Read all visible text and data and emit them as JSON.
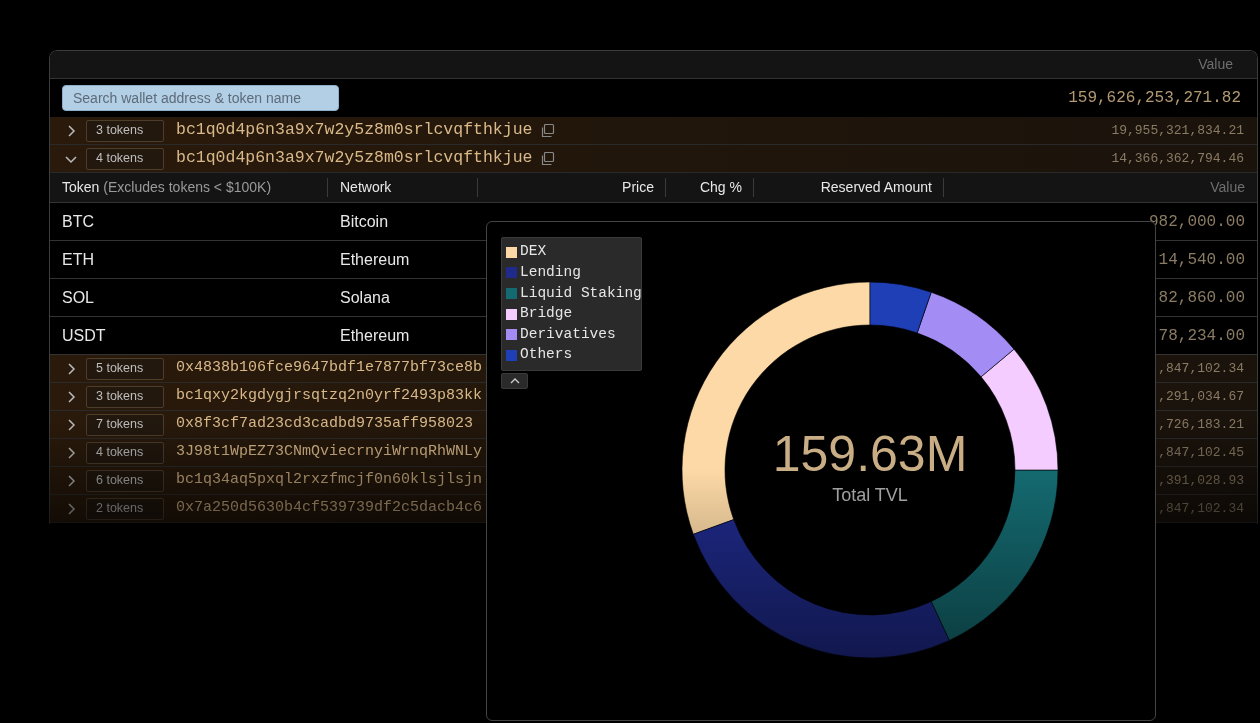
{
  "table": {
    "value_header": "Value",
    "search": {
      "placeholder": "Search wallet address & token name"
    },
    "total": "159,626,253,271.82",
    "wallets": [
      {
        "expanded": false,
        "count": "3 tokens",
        "address": "bc1q0d4p6n3a9x7w2y5z8m0srlcvqfthkjue",
        "copyable": true,
        "value": "19,955,321,834.21"
      },
      {
        "expanded": true,
        "count": "4 tokens",
        "address": "bc1q0d4p6n3a9x7w2y5z8m0srlcvqfthkjue",
        "copyable": true,
        "value": "14,366,362,794.46",
        "tokens": {
          "columns": [
            {
              "label": "Token",
              "note": "(Excludes tokens < $100K)"
            },
            {
              "label": "Network"
            },
            {
              "label": "Price"
            },
            {
              "label": "Chg %"
            },
            {
              "label": "Reserved Amount"
            },
            {
              "label": "Value"
            }
          ],
          "rows": [
            {
              "token": "BTC",
              "network": "Bitcoin",
              "value": "982,000.00"
            },
            {
              "token": "ETH",
              "network": "Ethereum",
              "value": "14,540.00"
            },
            {
              "token": "SOL",
              "network": "Solana",
              "value": "82,860.00"
            },
            {
              "token": "USDT",
              "network": "Ethereum",
              "value": "78,234.00"
            }
          ]
        }
      },
      {
        "expanded": false,
        "count": "5 tokens",
        "address": "0x4838b106fce9647bdf1e7877bf73ce8b",
        "value": ",847,102.34"
      },
      {
        "expanded": false,
        "count": "3 tokens",
        "address": "bc1qxy2kgdygjrsqtzq2n0yrf2493p83kk",
        "value": ",291,034.67"
      },
      {
        "expanded": false,
        "count": "7 tokens",
        "address": "0x8f3cf7ad23cd3cadbd9735aff958023",
        "value": ",726,183.21"
      },
      {
        "expanded": false,
        "count": "4 tokens",
        "address": "3J98t1WpEZ73CNmQviecrnyiWrnqRhWNLy",
        "value": ",847,102.45"
      },
      {
        "expanded": false,
        "count": "6 tokens",
        "address": "bc1q34aq5pxql2rxzfmcjf0n60klsjlsjn",
        "value": ",391,028.93"
      },
      {
        "expanded": false,
        "count": "2 tokens",
        "address": "0x7a250d5630b4cf539739df2c5dacb4c6",
        "value": ",847,102.34"
      }
    ]
  },
  "tvl_panel": {
    "legend": [
      {
        "label": "DEX",
        "color": "#fcd9a6"
      },
      {
        "label": "Lending",
        "color": "#1f2a8a"
      },
      {
        "label": "Liquid Staking",
        "color": "#146a70"
      },
      {
        "label": "Bridge",
        "color": "#f5ccff"
      },
      {
        "label": "Derivatives",
        "color": "#a48cf5"
      },
      {
        "label": "Others",
        "color": "#1e3fb5"
      }
    ],
    "total": "159.63M",
    "total_label": "Total TVL"
  }
}
